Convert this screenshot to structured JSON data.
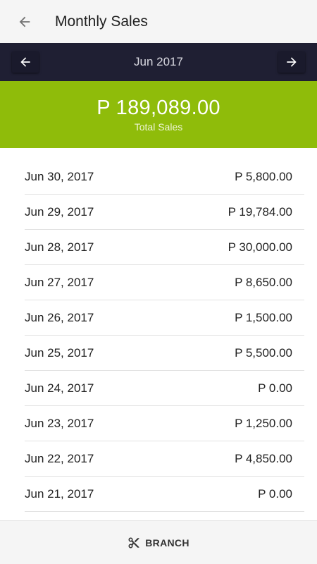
{
  "header": {
    "title": "Monthly Sales",
    "back_icon": "arrow-left-icon"
  },
  "month_nav": {
    "month": "Jun 2017",
    "prev_icon": "arrow-left-icon",
    "next_icon": "arrow-right-icon"
  },
  "summary": {
    "total": "P 189,089.00",
    "label": "Total Sales",
    "color": "#8fbc0a"
  },
  "sales": [
    {
      "date": "Jun 30, 2017",
      "amount": "P 5,800.00"
    },
    {
      "date": "Jun 29, 2017",
      "amount": "P 19,784.00"
    },
    {
      "date": "Jun 28, 2017",
      "amount": "P 30,000.00"
    },
    {
      "date": "Jun 27, 2017",
      "amount": "P 8,650.00"
    },
    {
      "date": "Jun 26, 2017",
      "amount": "P 1,500.00"
    },
    {
      "date": "Jun 25, 2017",
      "amount": "P 5,500.00"
    },
    {
      "date": "Jun 24, 2017",
      "amount": "P 0.00"
    },
    {
      "date": "Jun 23, 2017",
      "amount": "P 1,250.00"
    },
    {
      "date": "Jun 22, 2017",
      "amount": "P 4,850.00"
    },
    {
      "date": "Jun 21, 2017",
      "amount": "P 0.00"
    }
  ],
  "footer": {
    "branch_label": "BRANCH",
    "branch_icon": "scissors-icon"
  }
}
